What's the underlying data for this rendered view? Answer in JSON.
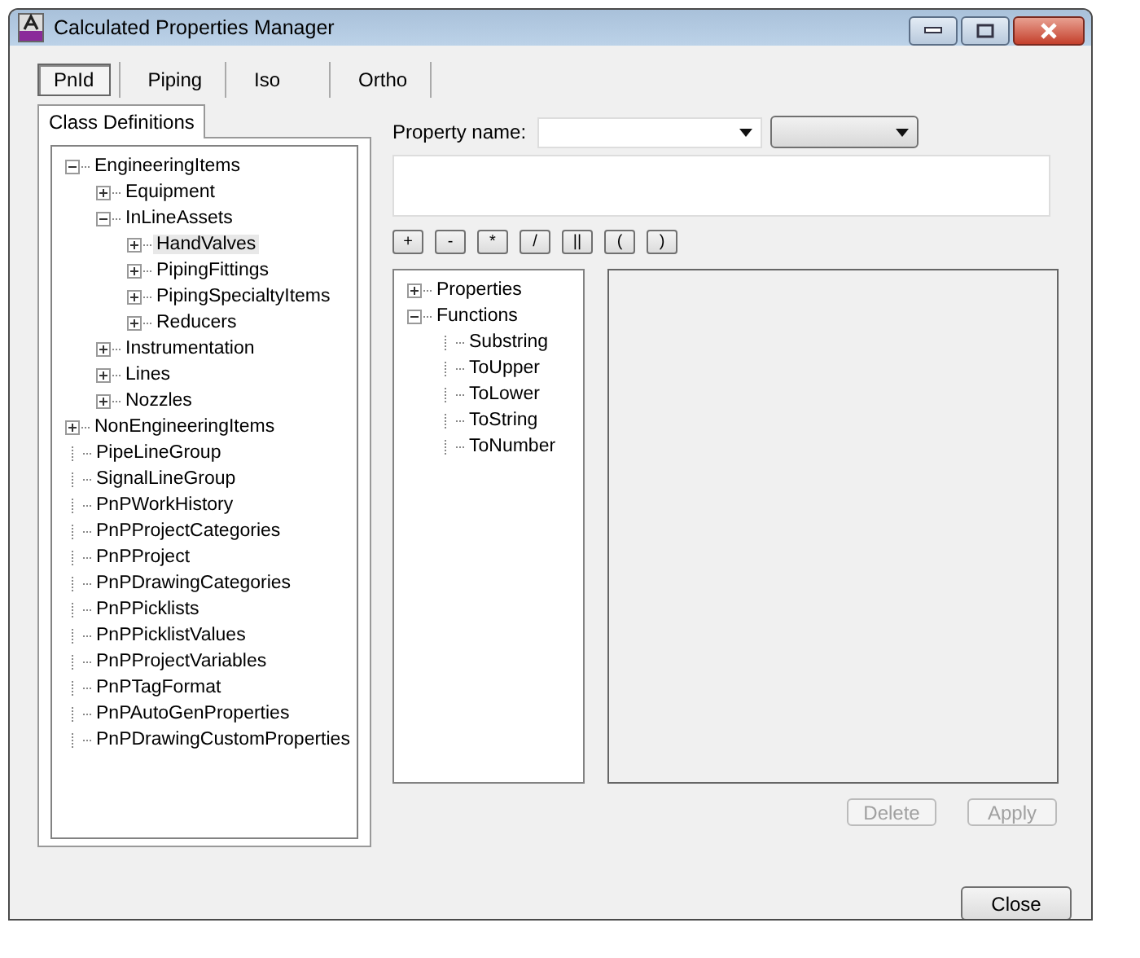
{
  "window": {
    "title": "Calculated Properties Manager"
  },
  "tabs": [
    {
      "label": "PnId",
      "selected": true
    },
    {
      "label": "Piping",
      "selected": false
    },
    {
      "label": "Iso",
      "selected": false
    },
    {
      "label": "Ortho",
      "selected": false
    }
  ],
  "class_panel": {
    "tab": "Class Definitions"
  },
  "class_tree": [
    {
      "label": "EngineeringItems",
      "expanded": true,
      "selected": false,
      "children": [
        {
          "label": "Equipment",
          "expanded": false,
          "selected": false
        },
        {
          "label": "InLineAssets",
          "expanded": true,
          "selected": false,
          "children": [
            {
              "label": "HandValves",
              "expanded": false,
              "selected": true
            },
            {
              "label": "PipingFittings",
              "expanded": false,
              "selected": false
            },
            {
              "label": "PipingSpecialtyItems",
              "expanded": false,
              "selected": false
            },
            {
              "label": "Reducers",
              "expanded": false,
              "selected": false
            }
          ]
        },
        {
          "label": "Instrumentation",
          "expanded": false,
          "selected": false
        },
        {
          "label": "Lines",
          "expanded": false,
          "selected": false
        },
        {
          "label": "Nozzles",
          "expanded": false,
          "selected": false
        }
      ]
    },
    {
      "label": "NonEngineeringItems",
      "expanded": false,
      "selected": false
    },
    {
      "label": "PipeLineGroup",
      "selected": false
    },
    {
      "label": "SignalLineGroup",
      "selected": false
    },
    {
      "label": "PnPWorkHistory",
      "selected": false
    },
    {
      "label": "PnPProjectCategories",
      "selected": false
    },
    {
      "label": "PnPProject",
      "selected": false
    },
    {
      "label": "PnPDrawingCategories",
      "selected": false
    },
    {
      "label": "PnPPicklists",
      "selected": false
    },
    {
      "label": "PnPPicklistValues",
      "selected": false
    },
    {
      "label": "PnPProjectVariables",
      "selected": false
    },
    {
      "label": "PnPTagFormat",
      "selected": false
    },
    {
      "label": "PnPAutoGenProperties",
      "selected": false
    },
    {
      "label": "PnPDrawingCustomProperties",
      "selected": false
    }
  ],
  "property_name": {
    "label": "Property name:"
  },
  "operators": [
    "+",
    "-",
    "*",
    "/",
    "||",
    "(",
    ")"
  ],
  "function_tree": [
    {
      "label": "Properties",
      "expanded": false,
      "selected": false
    },
    {
      "label": "Functions",
      "expanded": true,
      "selected": false,
      "children": [
        {
          "label": "Substring",
          "selected": false
        },
        {
          "label": "ToUpper",
          "selected": false
        },
        {
          "label": "ToLower",
          "selected": false
        },
        {
          "label": "ToString",
          "selected": false
        },
        {
          "label": "ToNumber",
          "selected": false
        }
      ]
    }
  ],
  "buttons": [
    {
      "label": "Delete",
      "disabled": true
    },
    {
      "label": "Apply",
      "disabled": true
    },
    {
      "label": "Close",
      "disabled": false
    }
  ]
}
